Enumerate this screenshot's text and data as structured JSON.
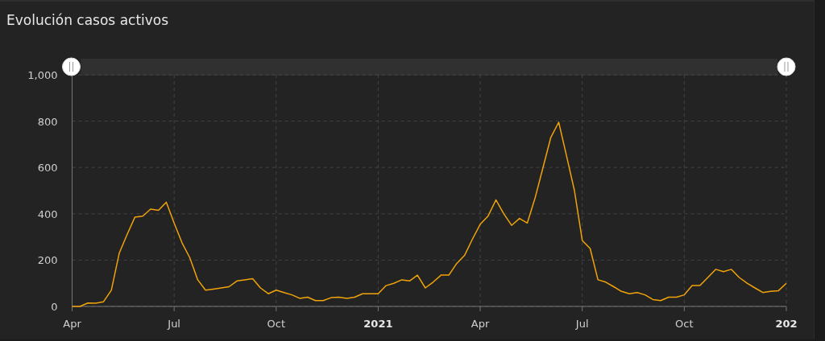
{
  "panel": {
    "title": "Evolución casos activos"
  },
  "chart_data": {
    "type": "line",
    "grid": true,
    "ylim": [
      0,
      1000
    ],
    "categories": [
      "Apr",
      null,
      null,
      null,
      null,
      null,
      null,
      null,
      null,
      null,
      null,
      null,
      null,
      "Jul",
      null,
      null,
      null,
      null,
      null,
      null,
      null,
      null,
      null,
      null,
      null,
      null,
      "Oct",
      null,
      null,
      null,
      null,
      null,
      null,
      null,
      null,
      null,
      null,
      null,
      null,
      "2021",
      null,
      null,
      null,
      null,
      null,
      null,
      null,
      null,
      null,
      null,
      null,
      null,
      "Apr",
      null,
      null,
      null,
      null,
      null,
      null,
      null,
      null,
      null,
      null,
      null,
      null,
      "Jul",
      null,
      null,
      null,
      null,
      null,
      null,
      null,
      null,
      null,
      null,
      null,
      null,
      "Oct",
      null,
      null,
      null,
      null,
      null,
      null,
      null,
      null,
      null,
      null,
      null,
      null,
      "202"
    ],
    "series": [
      {
        "color": "#f0a30a",
        "values": [
          0,
          0,
          15,
          14,
          20,
          70,
          230,
          310,
          385,
          390,
          420,
          415,
          450,
          360,
          275,
          210,
          115,
          70,
          75,
          80,
          85,
          110,
          115,
          120,
          80,
          55,
          70,
          60,
          50,
          35,
          40,
          25,
          25,
          38,
          40,
          35,
          40,
          55,
          55,
          55,
          90,
          100,
          115,
          110,
          135,
          80,
          105,
          135,
          135,
          185,
          220,
          290,
          355,
          390,
          460,
          400,
          350,
          380,
          360,
          470,
          600,
          730,
          795,
          650,
          500,
          285,
          250,
          115,
          105,
          85,
          65,
          55,
          60,
          50,
          30,
          25,
          40,
          40,
          50,
          90,
          90,
          125,
          160,
          150,
          160,
          125,
          100,
          80,
          60,
          65,
          68,
          100
        ]
      }
    ],
    "yticks": [
      0,
      200,
      400,
      600,
      800,
      {
        "value": 1000,
        "label": "1,000"
      }
    ]
  }
}
